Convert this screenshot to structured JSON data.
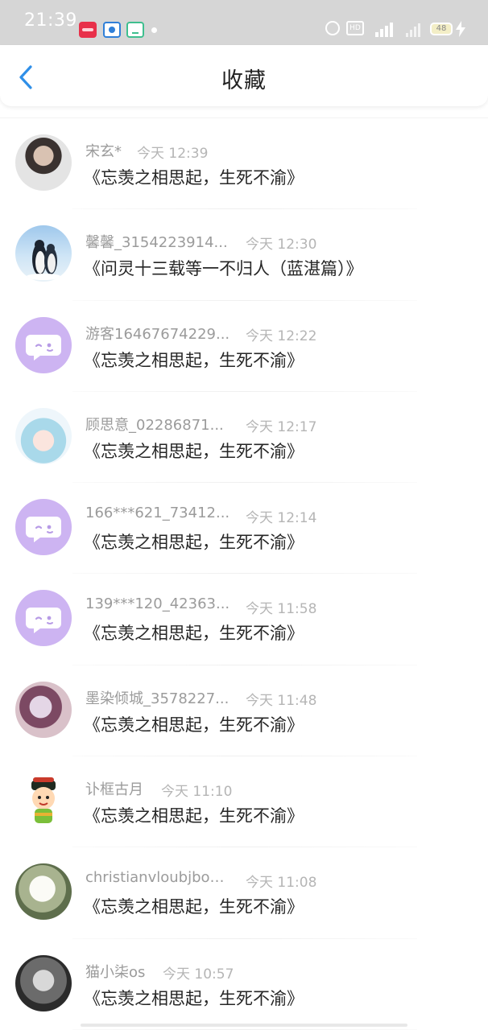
{
  "status_bar": {
    "time": "21:39",
    "hd_label": "HD",
    "battery": "48"
  },
  "header": {
    "title": "收藏",
    "back_icon": "chevron-left-icon",
    "accent_color": "#2f8fe8"
  },
  "items": [
    {
      "name": "宋玄*",
      "time": "今天 12:39",
      "title": "《忘羡之相思起，生死不渝》",
      "avatar": "photo-portrait"
    },
    {
      "name": "馨馨_3154223914...",
      "time": "今天 12:30",
      "title": "《问灵十三载等一不归人（蓝湛篇）》",
      "avatar": "photo-penguins"
    },
    {
      "name": "游客16467674229...",
      "time": "今天 12:22",
      "title": "《忘羡之相思起，生死不渝》",
      "avatar": "default-chat-avatar"
    },
    {
      "name": "顾思意_02286871...",
      "time": "今天 12:17",
      "title": "《忘羡之相思起，生死不渝》",
      "avatar": "anime-girl"
    },
    {
      "name": "166***621_73412...",
      "time": "今天 12:14",
      "title": "《忘羡之相思起，生死不渝》",
      "avatar": "default-chat-avatar"
    },
    {
      "name": "139***120_42363...",
      "time": "今天 11:58",
      "title": "《忘羡之相思起，生死不渝》",
      "avatar": "default-chat-avatar"
    },
    {
      "name": "墨染倾城_3578227...",
      "time": "今天 11:48",
      "title": "《忘羡之相思起，生死不渝》",
      "avatar": "anime-art"
    },
    {
      "name": "讣框古月",
      "time": "今天 11:10",
      "title": "《忘羡之相思起，生死不渝》",
      "avatar": "cartoon-kid"
    },
    {
      "name": "christianvloubjboul...",
      "time": "今天 11:08",
      "title": "《忘羡之相思起，生死不渝》",
      "avatar": "photo-flowers"
    },
    {
      "name": "猫小柒os",
      "time": "今天 10:57",
      "title": "《忘羡之相思起，生死不渝》",
      "avatar": "photo-dark"
    }
  ]
}
